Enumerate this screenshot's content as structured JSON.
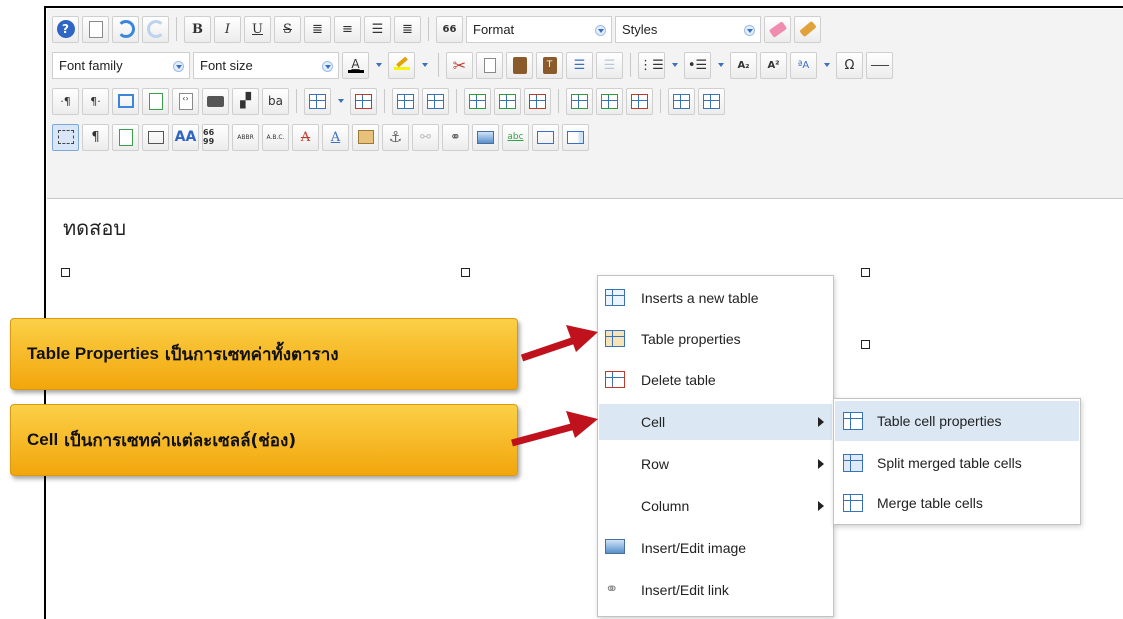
{
  "toolbar": {
    "row1": {
      "help_icon": "help-icon",
      "new_document_icon": "new-document-icon",
      "undo_icon": "undo-icon",
      "redo_icon": "redo-icon",
      "bold": "B",
      "italic": "I",
      "underline": "U",
      "strikethrough": "S",
      "blockquote": "66",
      "format_label": "Format",
      "styles_label": "Styles"
    },
    "row2": {
      "font_family_label": "Font family",
      "font_size_label": "Font size",
      "text_color_glyph": "A",
      "subscript": "A₂",
      "superscript": "A²",
      "char_map": "Ω"
    },
    "row3": {
      "ltr_glyph": "·¶",
      "rtl_glyph": "¶·",
      "abbr_glyph": "b͏a"
    },
    "row4": {
      "pilcrow": "¶",
      "font_color_glyph": "A",
      "cite": "66 99",
      "abbr": "ABBR",
      "acronym": "A.B.C.",
      "del": "A",
      "ins": "A",
      "spellcheck": "abc"
    }
  },
  "editor": {
    "body_text": "ทดสอบ"
  },
  "context_menu": {
    "items": [
      {
        "label": "Inserts a new table",
        "icon": "insert-table-icon"
      },
      {
        "label": "Table properties",
        "icon": "table-properties-icon"
      },
      {
        "label": "Delete table",
        "icon": "delete-table-icon"
      },
      {
        "label": "Cell",
        "icon": "",
        "has_submenu": true
      },
      {
        "label": "Row",
        "icon": "",
        "has_submenu": true
      },
      {
        "label": "Column",
        "icon": "",
        "has_submenu": true
      },
      {
        "label": "Insert/Edit image",
        "icon": "image-icon"
      },
      {
        "label": "Insert/Edit link",
        "icon": "link-icon"
      }
    ]
  },
  "cell_submenu": {
    "items": [
      {
        "label": "Table cell properties",
        "icon": "cell-properties-icon"
      },
      {
        "label": "Split merged table cells",
        "icon": "split-cells-icon"
      },
      {
        "label": "Merge table cells",
        "icon": "merge-cells-icon"
      }
    ]
  },
  "callouts": {
    "table_properties": {
      "bold_part": "Table Properties",
      "rest": " เป็นการเซทค่าทั้งตาราง"
    },
    "cell": {
      "bold_part": "Cell",
      "rest": " เป็นการเซทค่าแต่ละเซลล์(ช่อง)"
    }
  },
  "colors": {
    "callout_top": "#fbd047",
    "callout_bottom": "#f2a60c",
    "arrow": "#c0121c",
    "menu_hover": "#dbe8f3"
  }
}
